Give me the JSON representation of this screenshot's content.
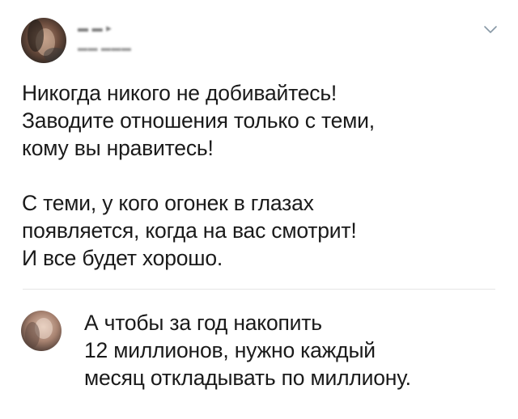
{
  "tweet": {
    "author_name": "▬ ▬ ▸",
    "author_handle": "▬▬ ▬▬▬",
    "lines": [
      "Никогда никого не добивайтесь!",
      "Заводите отношения только с теми,",
      "кому вы нравитесь!",
      "",
      "С теми, у кого огонек в глазах",
      "появляется, когда на вас смотрит!",
      "И все будет хорошо."
    ]
  },
  "reply": {
    "lines": [
      "А чтобы за год накопить",
      "12 миллионов, нужно каждый",
      "месяц откладывать по миллиону."
    ]
  },
  "icons": {
    "menu": "chevron-down-icon"
  },
  "colors": {
    "background": "#ffffff",
    "text": "#1a1a1a",
    "divider": "#e6e6e6",
    "chevron": "#8899a6"
  }
}
